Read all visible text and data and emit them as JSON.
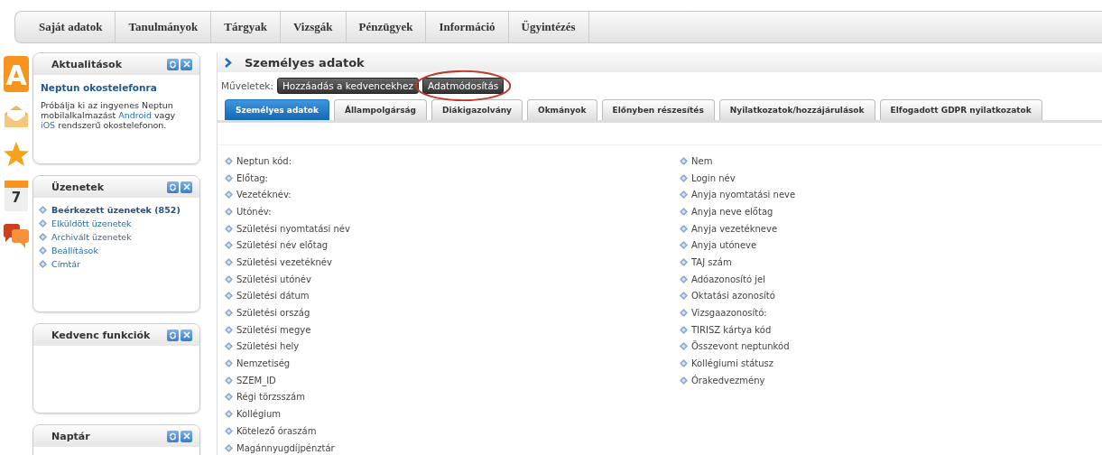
{
  "menu": [
    {
      "label": "Saját adatok"
    },
    {
      "label": "Tanulmányok"
    },
    {
      "label": "Tárgyak"
    },
    {
      "label": "Vizsgák"
    },
    {
      "label": "Pénzügyek"
    },
    {
      "label": "Információ"
    },
    {
      "label": "Ügyintézés"
    }
  ],
  "side_icons": [
    {
      "kind": "letter",
      "label": "A"
    },
    {
      "kind": "envelope"
    },
    {
      "kind": "star"
    },
    {
      "kind": "calendar",
      "label": "7"
    },
    {
      "kind": "chat"
    }
  ],
  "widgets": [
    {
      "kind": "news",
      "title": "Aktualitások",
      "headline": "Neptun okostelefonra",
      "body": "Próbálja ki az ingyenes Neptun mobilalkalmazást",
      "link_1": "Android",
      "middle": "vagy",
      "link_2": "iOS",
      "tail": "rendszerű okostelefonon."
    },
    {
      "kind": "list",
      "title": "Üzenetek",
      "items": [
        {
          "label": "Beérkezett üzenetek (852)",
          "selected": true
        },
        {
          "label": "Elküldött üzenetek",
          "selected": false
        },
        {
          "label": "Archivált üzenetek",
          "selected": false
        },
        {
          "label": "Beállítások",
          "selected": false
        },
        {
          "label": "Címtár",
          "selected": false
        }
      ]
    },
    {
      "kind": "empty",
      "title": "Kedvenc funkciók"
    },
    {
      "kind": "cut",
      "title": "Naptár"
    }
  ],
  "panel": {
    "title": "Személyes adatok",
    "actions_label": "Műveletek:",
    "actions": [
      {
        "label": "Hozzáadás a kedvencekhez",
        "circled": false
      },
      {
        "label": "Adatmódosítás",
        "circled": true
      }
    ],
    "tabs": [
      {
        "label": "Személyes adatok",
        "selected": true
      },
      {
        "label": "Állampolgárság",
        "selected": false
      },
      {
        "label": "Diákigazolvány",
        "selected": false
      },
      {
        "label": "Okmányok",
        "selected": false
      },
      {
        "label": "Előnyben részesítés",
        "selected": false
      },
      {
        "label": "Nyilatkozatok/hozzájárulások",
        "selected": false
      },
      {
        "label": "Elfogadott GDPR nyilatkozatok",
        "selected": false
      }
    ],
    "fields_left": [
      "Neptun kód:",
      "Előtag:",
      "Vezetéknév:",
      "Utónév:",
      "Születési nyomtatási név",
      "Születési név előtag",
      "Születési vezetéknév",
      "Születési utónév",
      "Születési dátum",
      "Születési ország",
      "Születési megye",
      "Születési hely",
      "Nemzetiség",
      "SZEM_ID",
      "Régi törzsszám",
      "Kollégium",
      "Kötelező óraszám",
      "Magánnyugdíjpénztár"
    ],
    "fields_right": [
      "Nem",
      "Login név",
      "Anyja nyomtatási neve",
      "Anyja neve előtag",
      "Anyja vezetékneve",
      "Anyja utóneve",
      "TAJ szám",
      "Adóazonosító jel",
      "Oktatási azonosító",
      "Vizsgaazonosító:",
      "TIRISZ kártya kód",
      "Összevont neptunkód",
      "Kollégiumi státusz",
      "Órakedvezmény"
    ]
  }
}
